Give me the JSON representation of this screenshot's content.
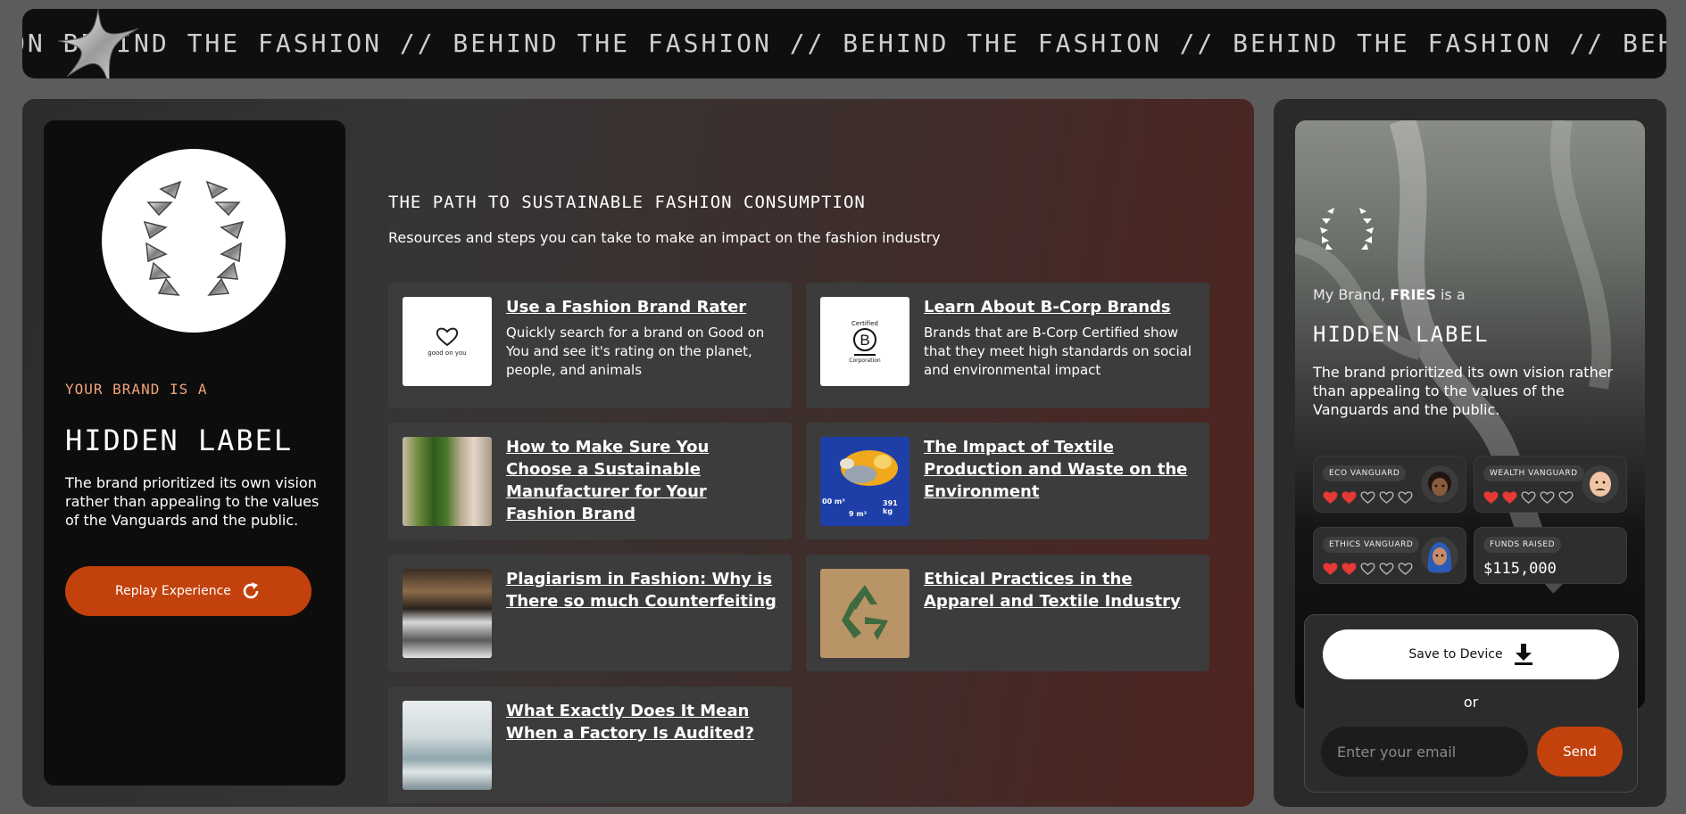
{
  "marquee": {
    "text": "ON BEHIND THE FASHION // BEHIND THE FASHION // BEHIND THE FASHION // BEHIND THE FASHION // BEHIND THE FASHION"
  },
  "result": {
    "eyebrow": "YOUR BRAND IS A",
    "title": "HIDDEN LABEL",
    "description": "The brand prioritized its own vision rather than appealing to the values of the Vanguards and the public.",
    "replay_label": "Replay Experience"
  },
  "path": {
    "title": "THE PATH TO SUSTAINABLE FASHION CONSUMPTION",
    "subtitle": "Resources and steps you can take to make an impact on the fashion industry"
  },
  "resources": [
    {
      "title": "Use a Fashion Brand Rater",
      "description": "Quickly search for a brand on Good on You and see it's rating on the planet, people, and animals",
      "thumb_text": "good on you"
    },
    {
      "title": "Learn About B-Corp Brands",
      "description": "Brands that are B-Corp Certified show that they meet high standards on social and environmental impact",
      "thumb_text_top": "Certified",
      "thumb_text_bottom": "Corporation"
    },
    {
      "title": "How to Make Sure You Choose a Sustainable Manufacturer for Your Fashion Brand",
      "description": ""
    },
    {
      "title": "The Impact of Textile Production and Waste on the Environment",
      "description": "",
      "thumb_stats": [
        "00 m³",
        "391 kg",
        "9 m²"
      ]
    },
    {
      "title": "Plagiarism in Fashion: Why is There so much Counterfeiting",
      "description": ""
    },
    {
      "title": "Ethical Practices in the Apparel and Textile Industry",
      "description": ""
    },
    {
      "title": "What Exactly Does It Mean When a Factory Is Audited?",
      "description": ""
    }
  ],
  "share": {
    "my_brand_prefix": "My Brand,",
    "brand_name": "FRIES",
    "my_brand_suffix": "is a",
    "title": "HIDDEN LABEL",
    "description": "The brand prioritized its own vision rather than appealing to the values of the Vanguards and the public.",
    "stats": [
      {
        "label": "ECO VANGUARD",
        "rating": 2,
        "max": 5
      },
      {
        "label": "WEALTH VANGUARD",
        "rating": 2,
        "max": 5
      },
      {
        "label": "ETHICS VANGUARD",
        "rating": 2,
        "max": 5
      }
    ],
    "funds": {
      "label": "FUNDS RAISED",
      "value": "$115,000"
    },
    "save_label": "Save to Device",
    "or_label": "or",
    "email_placeholder": "Enter your email",
    "send_label": "Send"
  },
  "colors": {
    "accent": "#c2410c",
    "heart": "#e53935",
    "eyebrow": "#f1a37a"
  }
}
